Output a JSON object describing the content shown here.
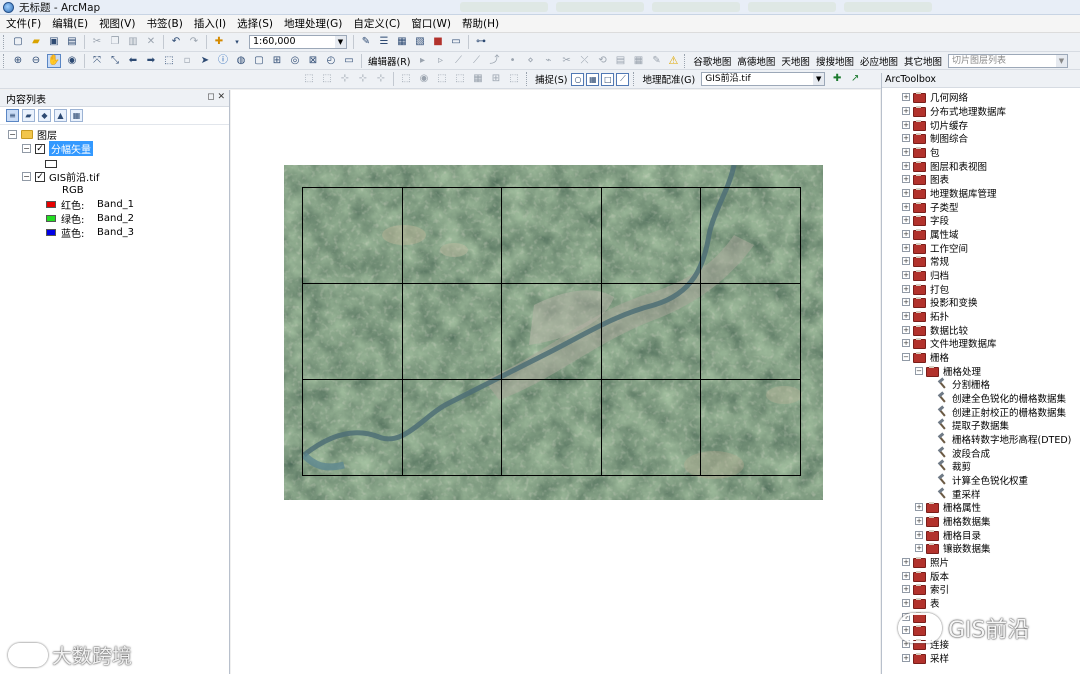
{
  "window": {
    "title": "无标题 - ArcMap"
  },
  "menu": [
    "文件(F)",
    "编辑(E)",
    "视图(V)",
    "书签(B)",
    "插入(I)",
    "选择(S)",
    "地理处理(G)",
    "自定义(C)",
    "窗口(W)",
    "帮助(H)"
  ],
  "toolbar": {
    "scale": "1:60,000",
    "editor_label": "编辑器(R)",
    "basemaps": [
      "谷歌地图",
      "高德地图",
      "天地图",
      "搜搜地图",
      "必应地图",
      "其它地图"
    ],
    "tile_layer_placeholder": "切片图层列表",
    "snapping_label": "捕捉(S)",
    "georef_label": "地理配准(G)",
    "georef_layer": "GIS前沿.tif"
  },
  "toc": {
    "title": "内容列表",
    "root": "图层",
    "layers": [
      {
        "name": "分幅矢量",
        "checked": true,
        "selected": true
      },
      {
        "name": "GIS前沿.tif",
        "checked": true,
        "selected": false
      }
    ],
    "rgb_label": "RGB",
    "bands": [
      {
        "label": "红色:",
        "band": "Band_1",
        "color": "#e60000"
      },
      {
        "label": "绿色:",
        "band": "Band_2",
        "color": "#22dd22"
      },
      {
        "label": "蓝色:",
        "band": "Band_3",
        "color": "#0000e6"
      }
    ]
  },
  "toolbox": {
    "title": "ArcToolbox",
    "top_items": [
      "几何网络",
      "分布式地理数据库",
      "切片缓存",
      "制图综合",
      "包",
      "图层和表视图",
      "图表",
      "地理数据库管理",
      "子类型",
      "字段",
      "属性域",
      "工作空间",
      "常规",
      "归档",
      "打包",
      "投影和变换",
      "拓扑",
      "数据比较",
      "文件地理数据库"
    ],
    "raster": "栅格",
    "raster_processing": "栅格处理",
    "tools": [
      "分割栅格",
      "创建全色锐化的栅格数据集",
      "创建正射校正的栅格数据集",
      "提取子数据集",
      "栅格转数字地形高程(DTED)",
      "波段合成",
      "裁剪",
      "计算全色锐化权重",
      "重采样"
    ],
    "raster_sub": [
      "栅格属性",
      "栅格数据集",
      "栅格目录",
      "镶嵌数据集"
    ],
    "bottom_items": [
      "照片",
      "版本",
      "索引",
      "表",
      "",
      "",
      "连接",
      "采样"
    ]
  },
  "colors": {
    "selection": "#3399ff",
    "toolbox_icon": "#b2322c",
    "panel_header": "#eef1f5"
  },
  "watermarks": {
    "left": "大数跨境",
    "right": "GIS前沿"
  }
}
